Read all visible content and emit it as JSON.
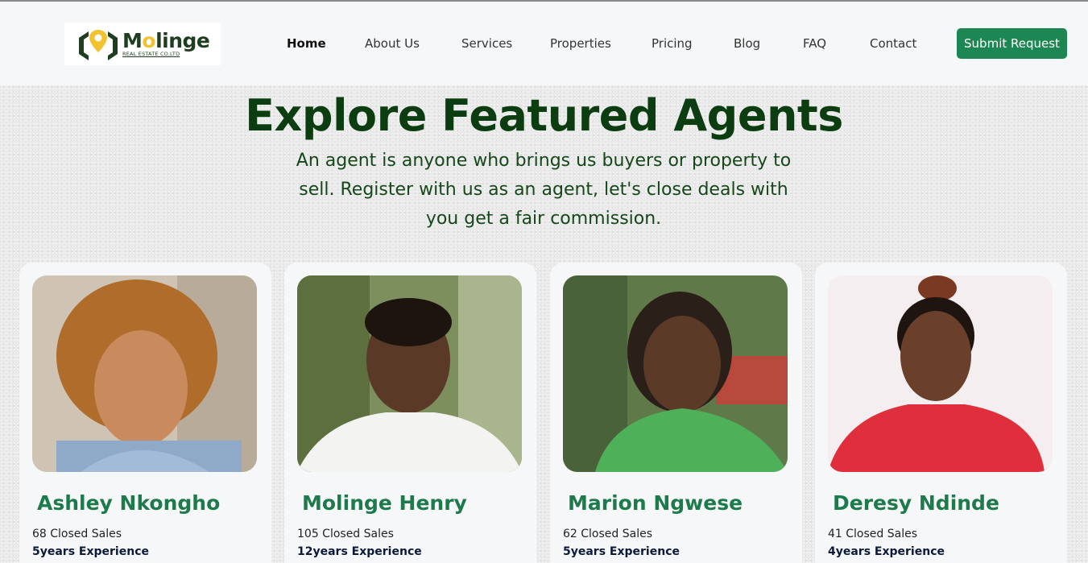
{
  "brand": {
    "name_prefix": "M",
    "name_o": "o",
    "name_rest": "linge",
    "subtitle": "REAL ESTATE CO.LTD"
  },
  "nav": {
    "items": [
      {
        "label": "Home",
        "active": true
      },
      {
        "label": "About Us"
      },
      {
        "label": "Services"
      },
      {
        "label": "Properties"
      },
      {
        "label": "Pricing"
      },
      {
        "label": "Blog"
      },
      {
        "label": "FAQ"
      },
      {
        "label": "Contact"
      }
    ],
    "cta_label": "Submit Request"
  },
  "hero": {
    "title": "Explore Featured Agents",
    "subtitle": "An agent is anyone who brings us buyers or property to sell. Register with us as an agent, let's close deals with you get a fair commission."
  },
  "agents": [
    {
      "name": "Ashley Nkongho",
      "closed_sales": "68 Closed Sales",
      "experience": "5years Experience"
    },
    {
      "name": "Molinge Henry",
      "closed_sales": "105 Closed Sales",
      "experience": "12years Experience"
    },
    {
      "name": "Marion Ngwese",
      "closed_sales": "62 Closed Sales",
      "experience": "5years Experience"
    },
    {
      "name": "Deresy Ndinde",
      "closed_sales": "41 Closed Sales",
      "experience": "4years Experience"
    }
  ],
  "colors": {
    "brand_green": "#1d8754",
    "title_green": "#0b3d10",
    "agent_name_green": "#1d7a4a",
    "logo_yellow": "#f2c230"
  },
  "icons": {
    "logo": "location-pin-house-icon"
  }
}
